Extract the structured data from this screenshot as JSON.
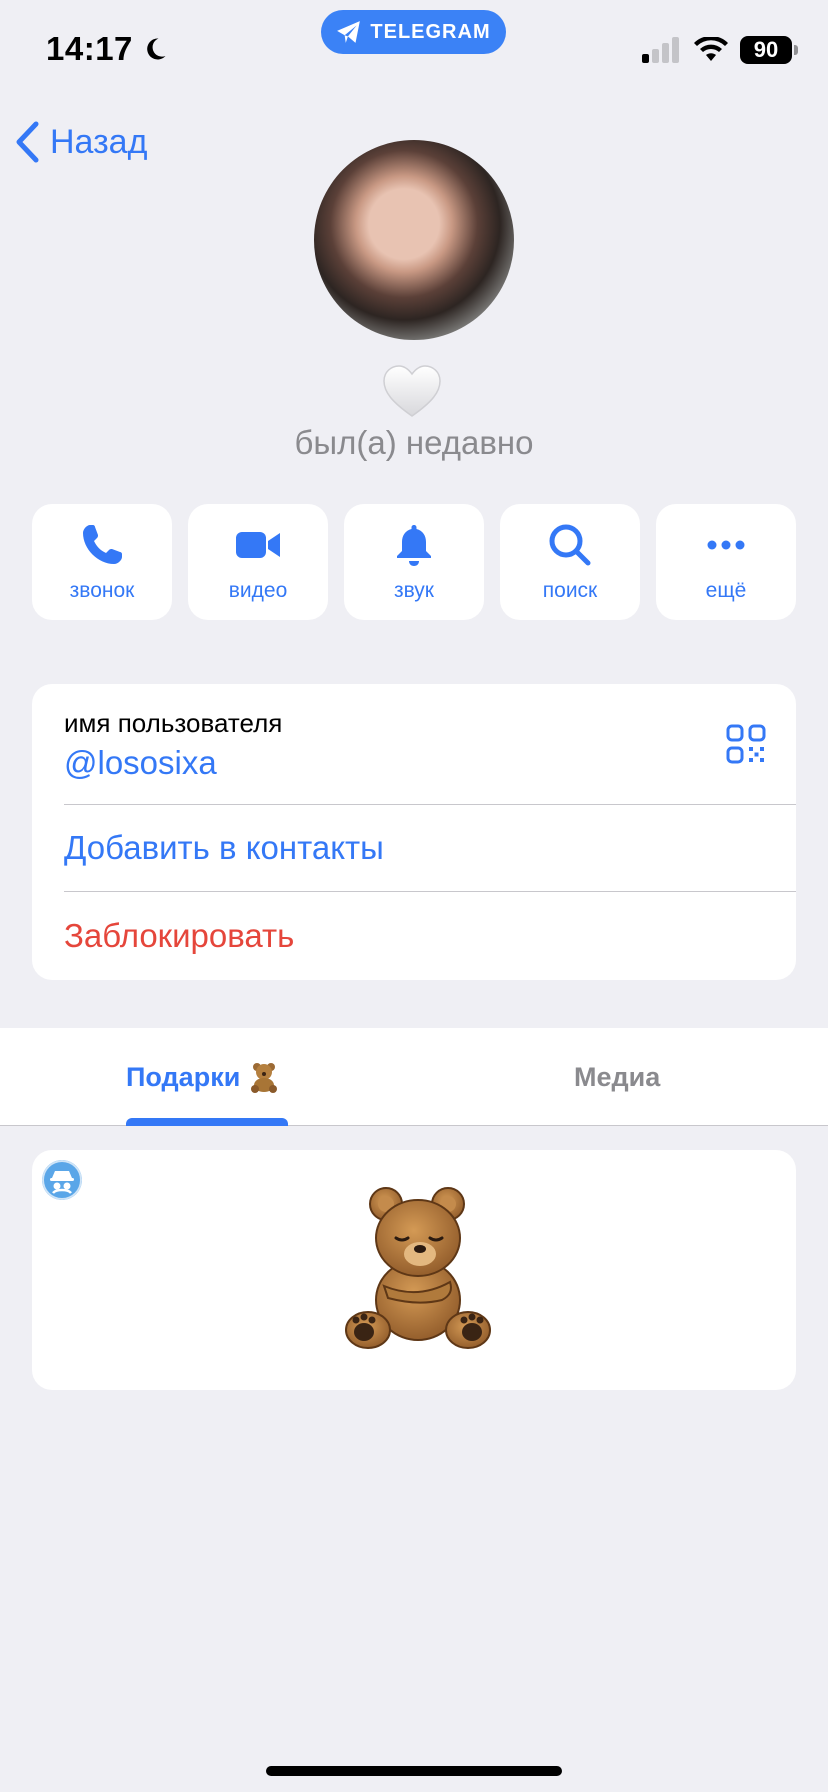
{
  "status_bar": {
    "time": "14:17",
    "app_pill": "TELEGRAM",
    "battery": "90"
  },
  "nav": {
    "back_label": "Назад"
  },
  "profile": {
    "last_seen": "был(а) недавно"
  },
  "actions": [
    {
      "label": "звонок",
      "icon": "phone-icon"
    },
    {
      "label": "видео",
      "icon": "video-icon"
    },
    {
      "label": "звук",
      "icon": "bell-icon"
    },
    {
      "label": "поиск",
      "icon": "search-icon"
    },
    {
      "label": "ещё",
      "icon": "more-icon"
    }
  ],
  "info": {
    "username_label": "имя пользователя",
    "username": "@lososixa",
    "add_contact": "Добавить в контакты",
    "block": "Заблокировать"
  },
  "tabs": {
    "gifts": "Подарки",
    "media": "Медиа",
    "active": "gifts"
  },
  "colors": {
    "accent": "#3478f6",
    "danger": "#e5463b",
    "background": "#efeff4",
    "secondary_text": "#8a8a8e"
  }
}
